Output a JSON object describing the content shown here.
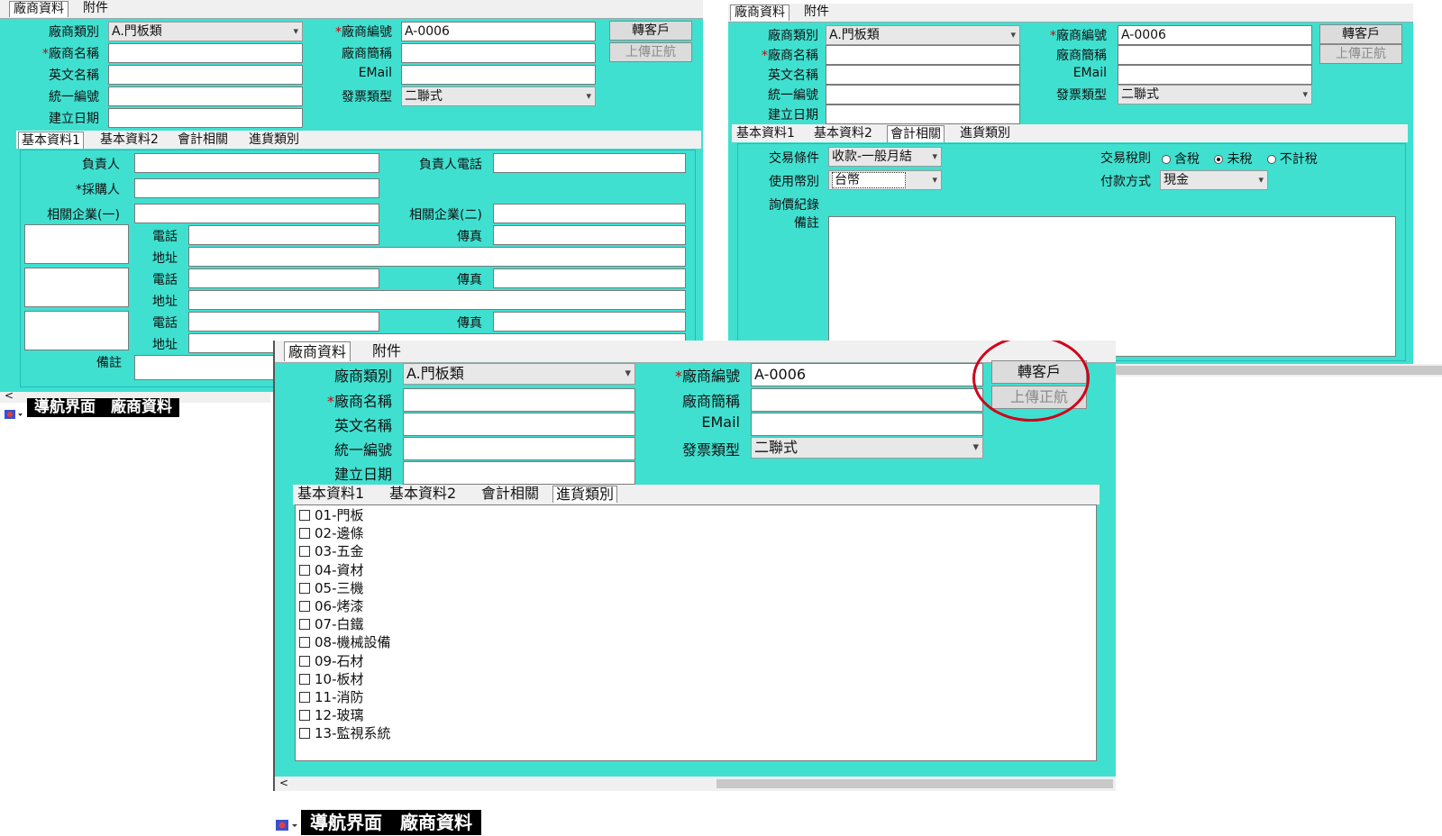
{
  "left_window": {
    "top_tabs": [
      "廠商資料",
      "附件"
    ],
    "fields": {
      "vendor_type_label": "廠商類別",
      "vendor_type_value": "A.門板類",
      "vendor_name_label": "廠商名稱",
      "english_name_label": "英文名稱",
      "tax_id_label": "統一編號",
      "created_date_label": "建立日期",
      "vendor_no_label": "廠商編號",
      "vendor_no_value": "A-0006",
      "short_name_label": "廠商簡稱",
      "email_label": "EMail",
      "invoice_type_label": "發票類型",
      "invoice_type_value": "二聯式"
    },
    "buttons": {
      "to_customer": "轉客戶",
      "upload": "上傳正航"
    },
    "sub_tabs": [
      "基本資料1",
      "基本資料2",
      "會計相關",
      "進貨類別"
    ],
    "basic1": {
      "owner_label": "負責人",
      "owner_phone_label": "負責人電話",
      "buyer_label": "採購人",
      "related1_label": "相關企業(一)",
      "related2_label": "相關企業(二)",
      "phone_label": "電話",
      "fax_label": "傳真",
      "address_label": "地址",
      "remarks_label": "備註"
    },
    "scroll_arrow": "<",
    "taskbar": "導航界面　廠商資料"
  },
  "right_window": {
    "top_tabs": [
      "廠商資料",
      "附件"
    ],
    "fields": {
      "vendor_type_label": "廠商類別",
      "vendor_type_value": "A.門板類",
      "vendor_name_label": "廠商名稱",
      "english_name_label": "英文名稱",
      "tax_id_label": "統一編號",
      "created_date_label": "建立日期",
      "vendor_no_label": "廠商編號",
      "vendor_no_value": "A-0006",
      "short_name_label": "廠商簡稱",
      "email_label": "EMail",
      "invoice_type_label": "發票類型",
      "invoice_type_value": "二聯式"
    },
    "buttons": {
      "to_customer": "轉客戶",
      "upload": "上傳正航"
    },
    "sub_tabs": [
      "基本資料1",
      "基本資料2",
      "會計相關",
      "進貨類別"
    ],
    "accounting": {
      "trade_terms_label": "交易條件",
      "trade_terms_value": "收款-一般月結",
      "currency_label": "使用幣別",
      "currency_value": "台幣",
      "inquiry_label": "詢價紀錄",
      "remarks_label": "備註",
      "tax_rule_label": "交易稅則",
      "tax_options": [
        "含稅",
        "未稅",
        "不計稅"
      ],
      "tax_selected": "未稅",
      "payment_label": "付款方式",
      "payment_value": "現金"
    }
  },
  "front_window": {
    "top_tabs": [
      "廠商資料",
      "附件"
    ],
    "fields": {
      "vendor_type_label": "廠商類別",
      "vendor_type_value": "A.門板類",
      "vendor_name_label": "廠商名稱",
      "english_name_label": "英文名稱",
      "tax_id_label": "統一編號",
      "created_date_label": "建立日期",
      "vendor_no_label": "廠商編號",
      "vendor_no_value": "A-0006",
      "short_name_label": "廠商簡稱",
      "email_label": "EMail",
      "invoice_type_label": "發票類型",
      "invoice_type_value": "二聯式"
    },
    "buttons": {
      "to_customer": "轉客戶",
      "upload": "上傳正航"
    },
    "sub_tabs": [
      "基本資料1",
      "基本資料2",
      "會計相關",
      "進貨類別"
    ],
    "purchase_categories": [
      "01-門板",
      "02-邊條",
      "03-五金",
      "04-資材",
      "05-三機",
      "06-烤漆",
      "07-白鐵",
      "08-機械設備",
      "09-石材",
      "10-板材",
      "11-消防",
      "12-玻璃",
      "13-監視系統"
    ],
    "scroll_arrow": "<",
    "taskbar": "導航界面　廠商資料"
  },
  "annotation_color": "#d0021b",
  "accent_color": "#40e0d0"
}
